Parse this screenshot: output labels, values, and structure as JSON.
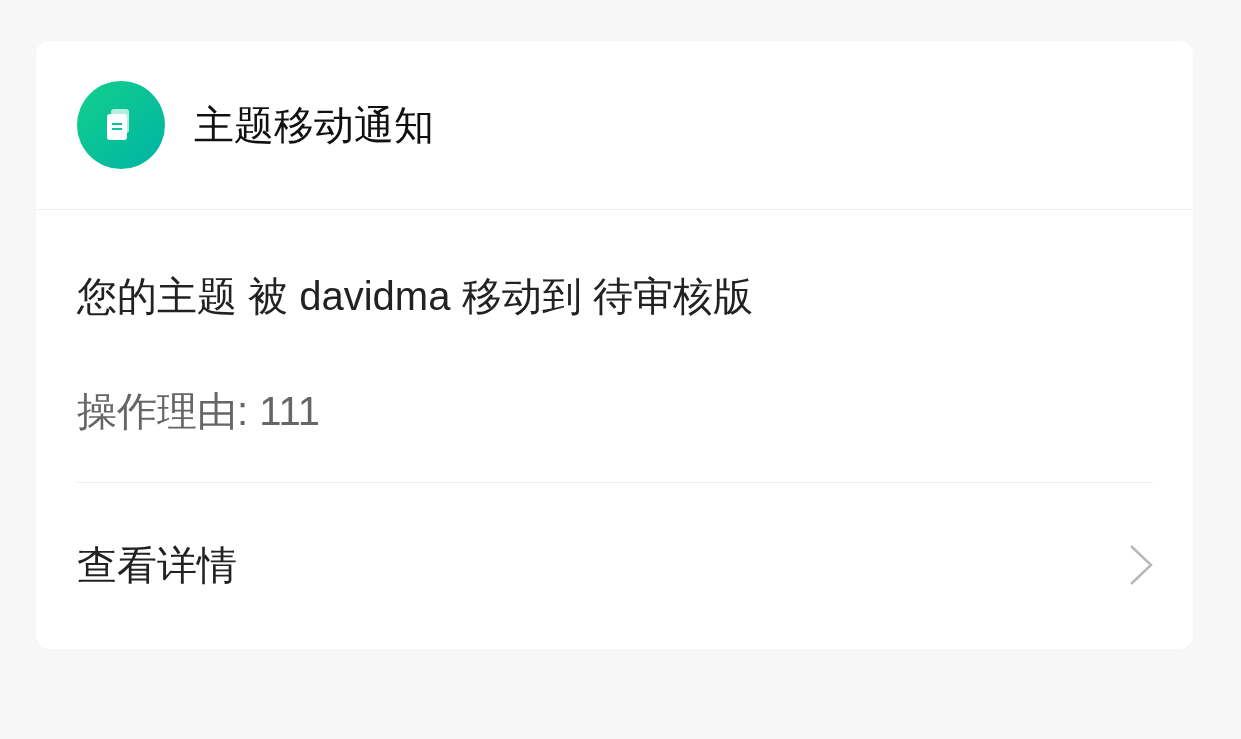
{
  "notice": {
    "title": "主题移动通知",
    "message": "您的主题 被 davidma 移动到 待审核版",
    "reason": "操作理由: 111",
    "link": "查看详情"
  }
}
